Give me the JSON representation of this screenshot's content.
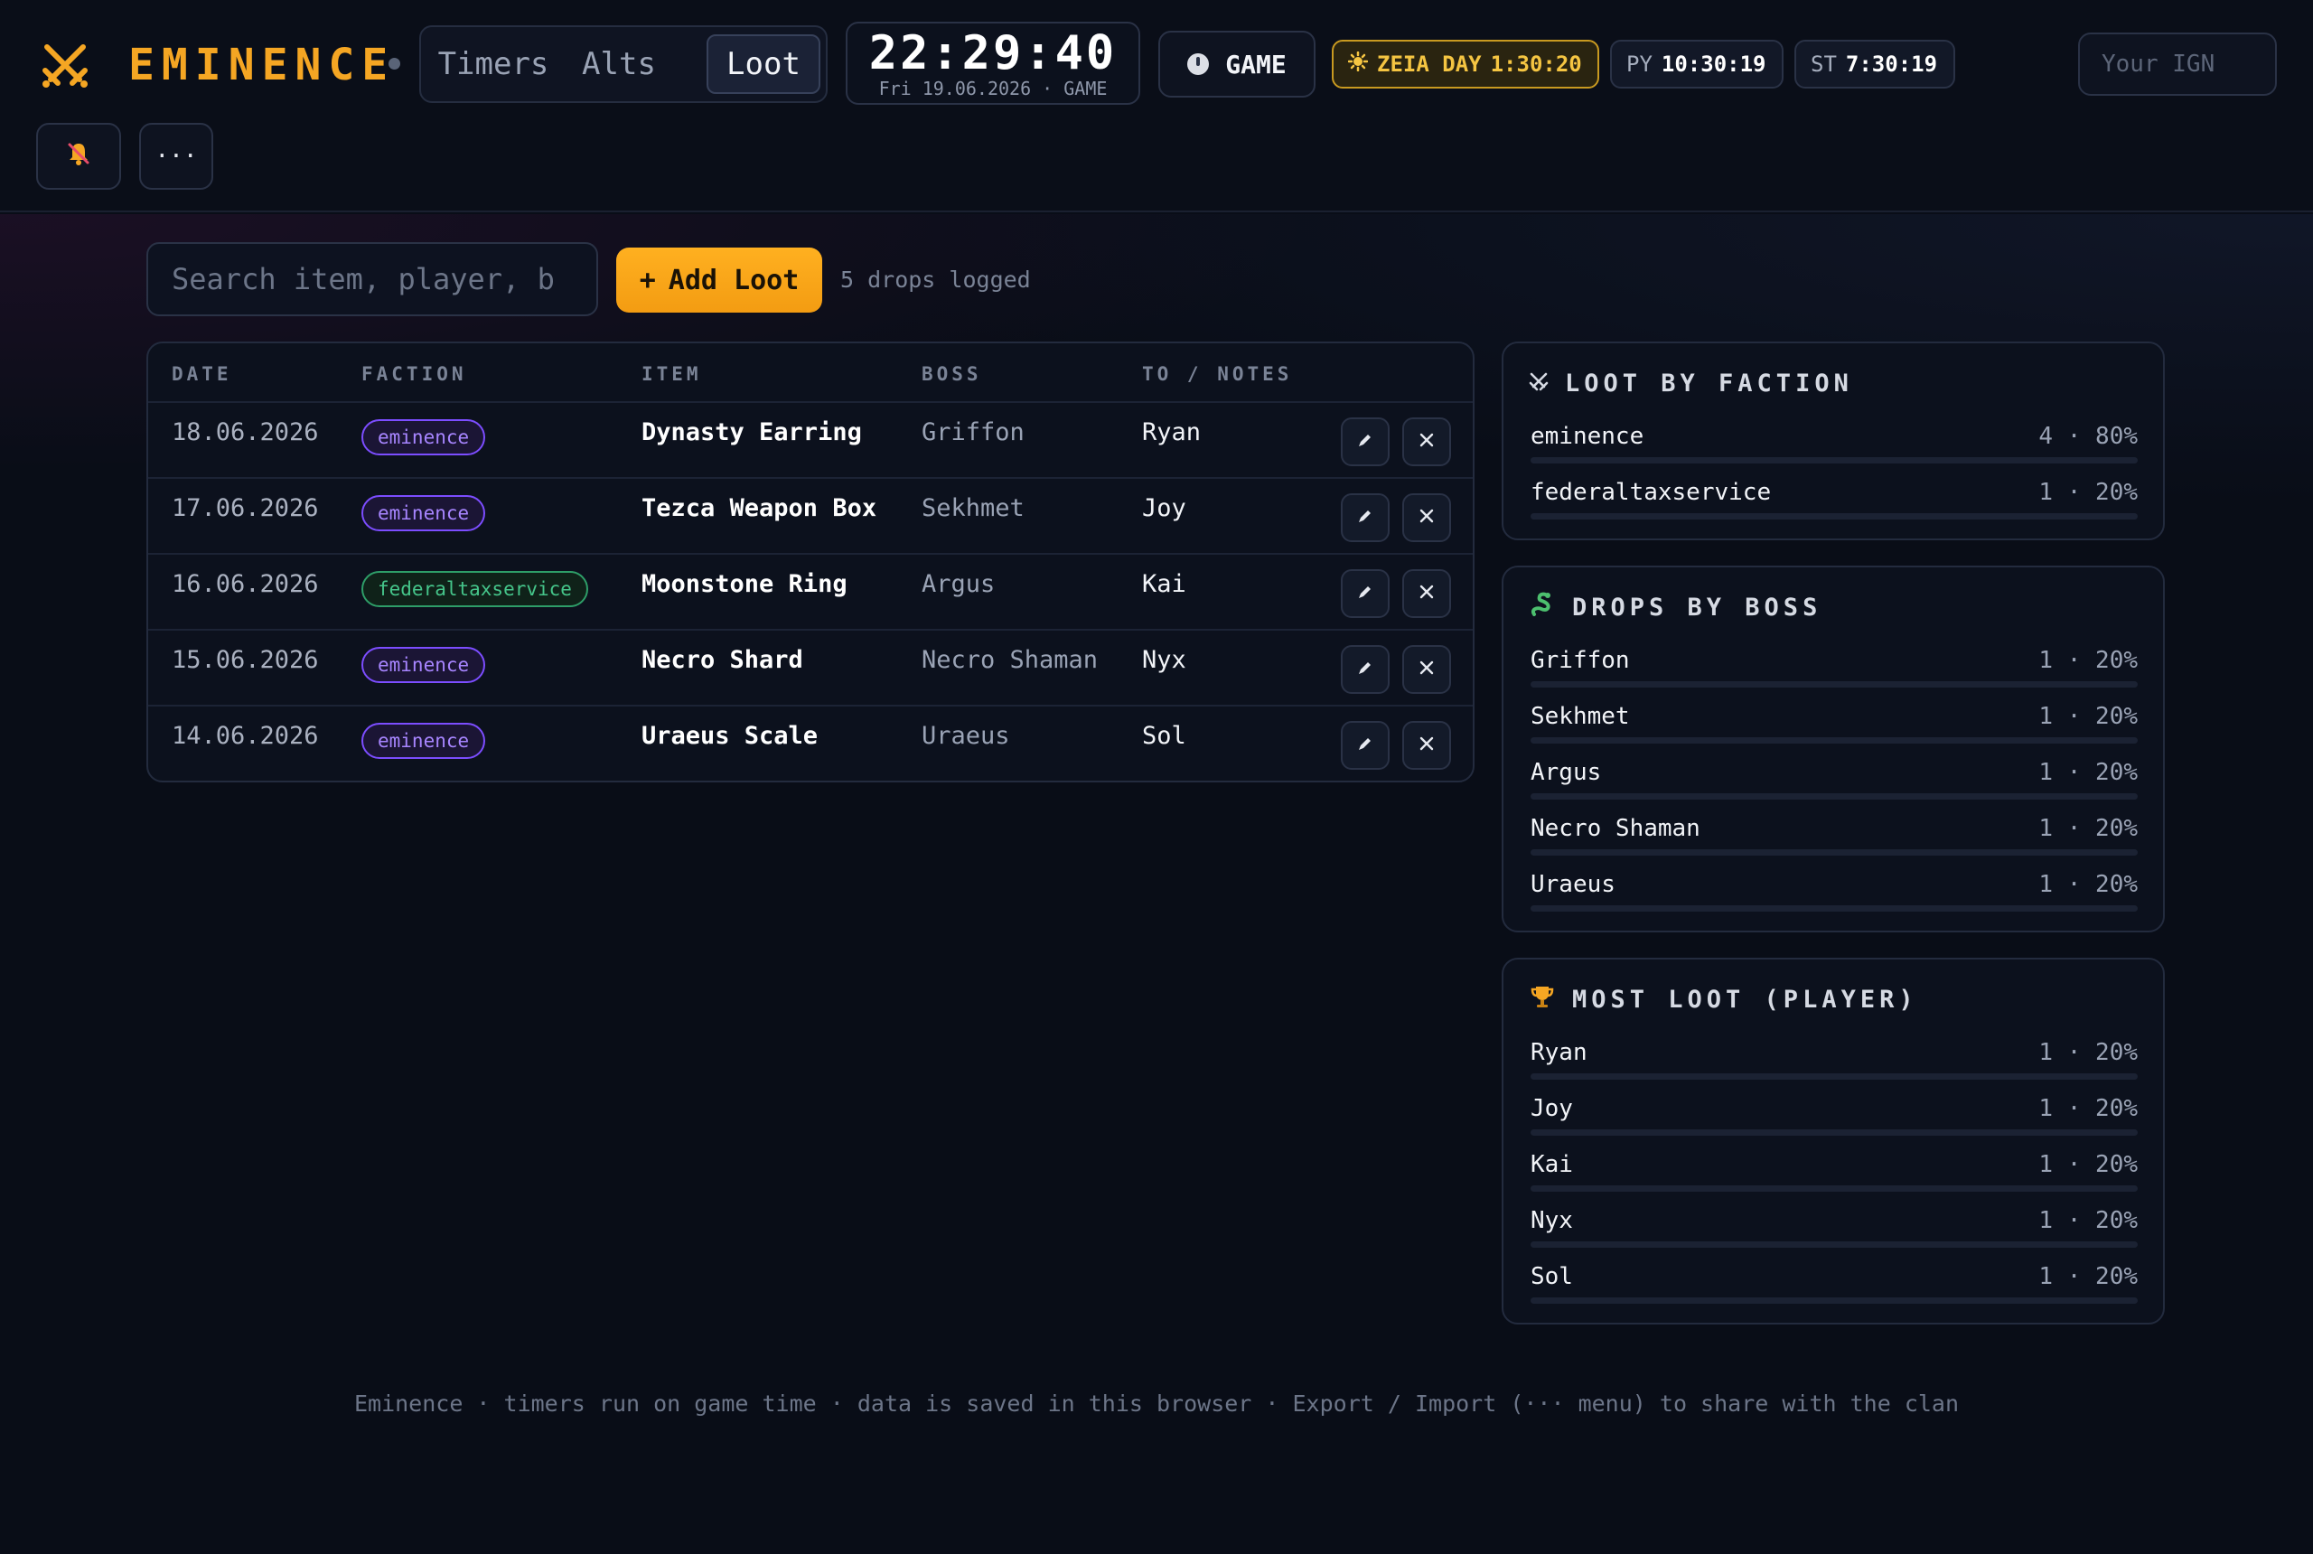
{
  "app": {
    "name": "EMINENCE",
    "accent_color": "#f5a623",
    "brand_icon": "crossed-swords-icon"
  },
  "nav": {
    "tabs": [
      {
        "label": "Timers",
        "active": false
      },
      {
        "label": "Alts",
        "active": false
      },
      {
        "label": "Loot",
        "active": true
      }
    ]
  },
  "clock": {
    "time": "22:29:40",
    "date": "Fri 19.06.2026 · GAME"
  },
  "game_button": {
    "label": "GAME",
    "icon": "clock-icon"
  },
  "days": {
    "zeia": {
      "label": "ZEIA DAY",
      "value": "1:30:20",
      "icon": "sun-icon",
      "color": "#f5c542"
    },
    "py": {
      "label": "PY",
      "value": "10:30:19"
    },
    "st": {
      "label": "ST",
      "value": "7:30:19"
    }
  },
  "ign": {
    "placeholder": "Your IGN",
    "value": ""
  },
  "toolbar": {
    "bell_icon": "bell-off-icon",
    "more_label": "···",
    "search_placeholder": "Search item, player, b",
    "add_label": "Add Loot",
    "add_symbol": "+",
    "drops_count": "5 drops logged"
  },
  "table": {
    "headers": {
      "date": "DATE",
      "faction": "FACTION",
      "item": "ITEM",
      "boss": "BOSS",
      "to": "TO / NOTES"
    },
    "rows": [
      {
        "date": "18.06.2026",
        "faction": "eminence",
        "item": "Dynasty Earring",
        "boss": "Griffon",
        "to": "Ryan"
      },
      {
        "date": "17.06.2026",
        "faction": "eminence",
        "item": "Tezca Weapon Box",
        "boss": "Sekhmet",
        "to": "Joy"
      },
      {
        "date": "16.06.2026",
        "faction": "federaltaxservice",
        "item": "Moonstone Ring",
        "boss": "Argus",
        "to": "Kai"
      },
      {
        "date": "15.06.2026",
        "faction": "eminence",
        "item": "Necro Shard",
        "boss": "Necro Shaman",
        "to": "Nyx"
      },
      {
        "date": "14.06.2026",
        "faction": "eminence",
        "item": "Uraeus Scale",
        "boss": "Uraeus",
        "to": "Sol"
      }
    ],
    "faction_colors": {
      "eminence": "#a785ff",
      "federaltaxservice": "#45c58a"
    }
  },
  "panels": {
    "by_faction": {
      "title": "LOOT BY FACTION",
      "icon": "crossed-swords-icon",
      "items": [
        {
          "name": "eminence",
          "value": "4 · 80%"
        },
        {
          "name": "federaltaxservice",
          "value": "1 · 20%"
        }
      ]
    },
    "by_boss": {
      "title": "DROPS BY BOSS",
      "icon": "snake-icon",
      "items": [
        {
          "name": "Griffon",
          "value": "1 · 20%"
        },
        {
          "name": "Sekhmet",
          "value": "1 · 20%"
        },
        {
          "name": "Argus",
          "value": "1 · 20%"
        },
        {
          "name": "Necro Shaman",
          "value": "1 · 20%"
        },
        {
          "name": "Uraeus",
          "value": "1 · 20%"
        }
      ]
    },
    "by_player": {
      "title": "MOST LOOT (PLAYER)",
      "icon": "trophy-icon",
      "items": [
        {
          "name": "Ryan",
          "value": "1 · 20%"
        },
        {
          "name": "Joy",
          "value": "1 · 20%"
        },
        {
          "name": "Kai",
          "value": "1 · 20%"
        },
        {
          "name": "Nyx",
          "value": "1 · 20%"
        },
        {
          "name": "Sol",
          "value": "1 · 20%"
        }
      ]
    }
  },
  "footer": "Eminence · timers run on game time · data is saved in this browser · Export / Import (··· menu) to share with the clan"
}
